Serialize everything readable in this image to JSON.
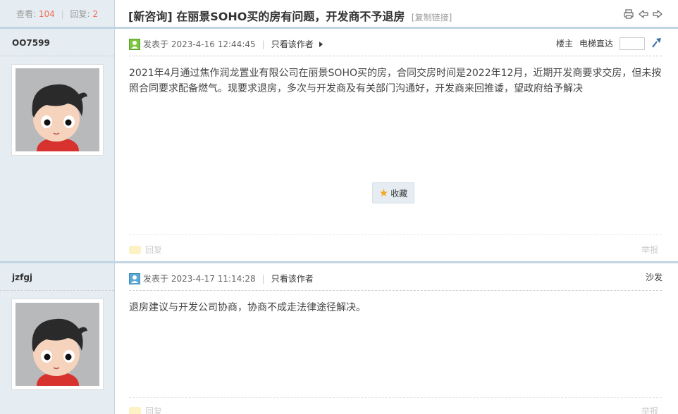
{
  "header": {
    "views_label": "查看:",
    "views_count": "104",
    "replies_label": "回复:",
    "replies_count": "2",
    "title": "[新咨询] 在丽景SOHO买的房有问题，开发商不予退房",
    "copy_link": "[复制链接]",
    "icons": [
      "print-icon",
      "prev-thread-icon",
      "next-thread-icon"
    ]
  },
  "posts": [
    {
      "author": "OO7599",
      "posted_label": "发表于 2023-4-16 12:44:45",
      "only_author": "只看该作者",
      "floor": "楼主",
      "goto_label": "电梯直达",
      "body": "2021年4月通过焦作润龙置业有限公司在丽景SOHO买的房，合同交房时间是2022年12月，近期开发商要求交房，但未按照合同要求配备燃气。现要求退房，多次与开发商及有关部门沟通好，开发商来回推诿，望政府给予解决",
      "favorite": "收藏",
      "reply": "回复",
      "report": "举报"
    },
    {
      "author": "jzfgj",
      "posted_label": "发表于 2023-4-17 11:14:28",
      "only_author": "只看该作者",
      "floor": "沙发",
      "body": "退房建议与开发公司协商，协商不成走法律途径解决。",
      "reply": "回复",
      "report": "举报"
    }
  ],
  "colors": {
    "sidebar_bg": "#e5edf2",
    "border": "#c2d5e3",
    "accent_count": "#f26c4f"
  }
}
